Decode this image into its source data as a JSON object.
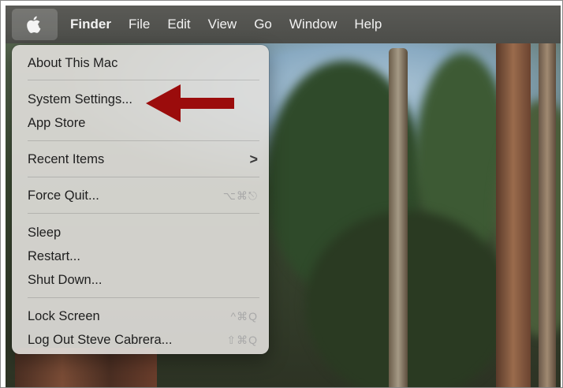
{
  "menubar": {
    "apple_icon": "apple-logo",
    "items": [
      "Finder",
      "File",
      "Edit",
      "View",
      "Go",
      "Window",
      "Help"
    ]
  },
  "apple_menu": {
    "about": "About This Mac",
    "system_settings": "System Settings...",
    "app_store": "App Store",
    "recent_items": "Recent Items",
    "recent_items_chevron": ">",
    "force_quit": "Force Quit...",
    "force_quit_shortcut": "⌥⌘⎋",
    "sleep": "Sleep",
    "restart": "Restart...",
    "shut_down": "Shut Down...",
    "lock_screen": "Lock Screen",
    "lock_screen_shortcut": "^⌘Q",
    "log_out": "Log Out Steve Cabrera...",
    "log_out_shortcut": "⇧⌘Q"
  },
  "annotation": {
    "arrow_color": "#9b0c0c",
    "arrow_target": "system-settings"
  }
}
